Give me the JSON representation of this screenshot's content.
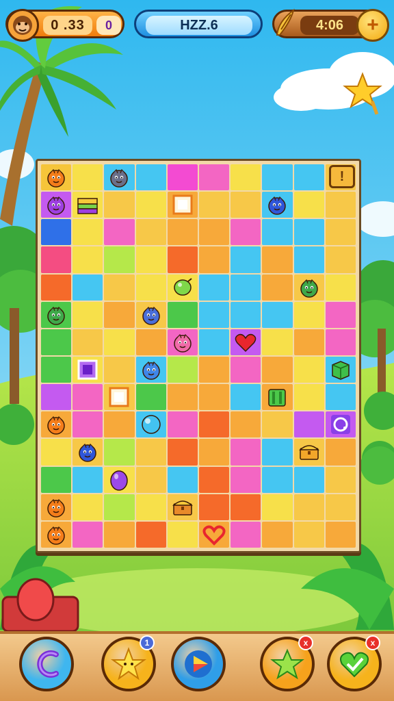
{
  "hud": {
    "score": "0 .33",
    "score_badge": "0",
    "level": "HZZ.6",
    "timer": "4:06",
    "plus_label": "+"
  },
  "board": {
    "menu_label": "!",
    "rows": [
      [
        "#f6c53a",
        "#f7e04a",
        "#45c6f2",
        "#45c6f2",
        "#f34bd2",
        "#f366c3",
        "#f7e04a",
        "#45c6f2",
        "#45c6f2",
        "#f7c848"
      ],
      [
        "#c45af0",
        "#f7e04a",
        "#f7c848",
        "#f7e04a",
        "#f7a93a",
        "#f7c848",
        "#f7c848",
        "#45c6f2",
        "#f7e04a",
        "#f7c848"
      ],
      [
        "#2f70e8",
        "#f7e04a",
        "#f366c3",
        "#f7c848",
        "#f7a93a",
        "#f7a93a",
        "#f366c3",
        "#45c6f2",
        "#45c6f2",
        "#f7c848"
      ],
      [
        "#f44d82",
        "#f7e04a",
        "#b5e84a",
        "#f7e04a",
        "#f56a2a",
        "#f7a93a",
        "#45c6f2",
        "#f7a93a",
        "#45c6f2",
        "#f7c848"
      ],
      [
        "#f56a2a",
        "#45c6f2",
        "#f7c848",
        "#f7e04a",
        "#f7e04a",
        "#45c6f2",
        "#45c6f2",
        "#f7a93a",
        "#f7c848",
        "#f7e04a"
      ],
      [
        "#4cc84a",
        "#f7e04a",
        "#f7a93a",
        "#f7c848",
        "#4cc84a",
        "#45c6f2",
        "#45c6f2",
        "#45c6f2",
        "#f7e04a",
        "#f366c3"
      ],
      [
        "#4cc84a",
        "#f7c848",
        "#f7e04a",
        "#f7a93a",
        "#f366c3",
        "#45c6f2",
        "#c45af0",
        "#f7e04a",
        "#f7a93a",
        "#f366c3"
      ],
      [
        "#4cc84a",
        "#f7e04a",
        "#f7c848",
        "#45c6f2",
        "#b5e84a",
        "#f7a93a",
        "#f366c3",
        "#f7a93a",
        "#f7e04a",
        "#45c6f2"
      ],
      [
        "#c45af0",
        "#f366c3",
        "#f7c848",
        "#4cc84a",
        "#f7a93a",
        "#f7a93a",
        "#45c6f2",
        "#f7a93a",
        "#f7e04a",
        "#45c6f2"
      ],
      [
        "#f7a93a",
        "#f366c3",
        "#f7a93a",
        "#45c6f2",
        "#f366c3",
        "#f56a2a",
        "#f7a93a",
        "#f7c848",
        "#c45af0",
        "#c45af0"
      ],
      [
        "#f7e04a",
        "#f7c848",
        "#b5e84a",
        "#f7c848",
        "#f56a2a",
        "#f7a93a",
        "#f366c3",
        "#45c6f2",
        "#f7c848",
        "#f7a93a"
      ],
      [
        "#4cc84a",
        "#45c6f2",
        "#f7e04a",
        "#f7c848",
        "#45c6f2",
        "#f56a2a",
        "#f366c3",
        "#45c6f2",
        "#45c6f2",
        "#f7c848"
      ],
      [
        "#f7a93a",
        "#f7e04a",
        "#b5e84a",
        "#f7e04a",
        "#f7c848",
        "#f56a2a",
        "#f56a2a",
        "#f7e04a",
        "#f7c848",
        "#f7c848"
      ],
      [
        "#f7a93a",
        "#f366c3",
        "#f7a93a",
        "#f56a2a",
        "#f7e04a",
        "#f7a93a",
        "#f366c3",
        "#f7a93a",
        "#f7c848",
        "#f7a93a"
      ]
    ],
    "pieces": [
      {
        "r": 0,
        "c": 0,
        "icon": "orange-blob-icon",
        "color": "#f47d1a"
      },
      {
        "r": 0,
        "c": 2,
        "icon": "gray-robot-icon",
        "color": "#6a6f8a"
      },
      {
        "r": 1,
        "c": 0,
        "icon": "purple-wizard-icon",
        "color": "#9d3fe0"
      },
      {
        "r": 1,
        "c": 1,
        "icon": "stack-box-icon",
        "color": "#7bd24a"
      },
      {
        "r": 1,
        "c": 4,
        "icon": "white-frame-icon",
        "color": "#ffffff"
      },
      {
        "r": 1,
        "c": 7,
        "icon": "blue-bird-icon",
        "color": "#2f56d8"
      },
      {
        "r": 4,
        "c": 4,
        "icon": "green-bubble-icon",
        "color": "#7fd84a"
      },
      {
        "r": 4,
        "c": 8,
        "icon": "green-hood-icon",
        "color": "#3fa84a"
      },
      {
        "r": 5,
        "c": 0,
        "icon": "green-turtle-icon",
        "color": "#3fa84a"
      },
      {
        "r": 5,
        "c": 3,
        "icon": "blue-robot-icon",
        "color": "#4a6ed8"
      },
      {
        "r": 6,
        "c": 4,
        "icon": "pink-blob-icon",
        "color": "#f06aa8"
      },
      {
        "r": 6,
        "c": 6,
        "icon": "heart-icon",
        "color": "#e8262e"
      },
      {
        "r": 7,
        "c": 1,
        "icon": "purple-frame-icon",
        "color": "#8a2fe0"
      },
      {
        "r": 7,
        "c": 3,
        "icon": "blue-blob-icon",
        "color": "#3f86e8"
      },
      {
        "r": 7,
        "c": 9,
        "icon": "green-box-icon",
        "color": "#3fbf4a"
      },
      {
        "r": 8,
        "c": 2,
        "icon": "white-frame-icon",
        "color": "#ffffff"
      },
      {
        "r": 8,
        "c": 7,
        "icon": "green-gate-icon",
        "color": "#4cc84a"
      },
      {
        "r": 9,
        "c": 0,
        "icon": "orange-blob-icon",
        "color": "#f47d1a"
      },
      {
        "r": 9,
        "c": 3,
        "icon": "cyan-orb-icon",
        "color": "#43c3f0"
      },
      {
        "r": 9,
        "c": 9,
        "icon": "purple-ring-icon",
        "color": "#6a22c8"
      },
      {
        "r": 10,
        "c": 1,
        "icon": "blue-bird-icon",
        "color": "#2f56d8"
      },
      {
        "r": 10,
        "c": 8,
        "icon": "treasure-chest-icon",
        "color": "#f2a62a"
      },
      {
        "r": 11,
        "c": 2,
        "icon": "purple-gem-icon",
        "color": "#9b4ae8"
      },
      {
        "r": 12,
        "c": 0,
        "icon": "orange-blob-icon",
        "color": "#f47d1a"
      },
      {
        "r": 12,
        "c": 4,
        "icon": "treasure-chest-icon",
        "color": "#e88a2a"
      },
      {
        "r": 13,
        "c": 0,
        "icon": "orange-blob-icon",
        "color": "#f47d1a"
      },
      {
        "r": 13,
        "c": 5,
        "icon": "heart-outline-icon",
        "color": "#e8262e"
      }
    ]
  },
  "actions": [
    {
      "name": "undo-button",
      "icon": "undo-icon",
      "bg": "#3fb6ef",
      "badge": ""
    },
    {
      "name": "star-hint-button",
      "icon": "star-icon",
      "bg": "#f6b31c",
      "badge": "1"
    },
    {
      "name": "play-button",
      "icon": "play-icon",
      "bg": "#2f9ee8",
      "badge": ""
    },
    {
      "name": "green-star-button",
      "icon": "green-star-icon",
      "bg": "#f6a21c",
      "badge": "x"
    },
    {
      "name": "heart-boost-button",
      "icon": "green-heart-icon",
      "bg": "#f6b31c",
      "badge": "x"
    }
  ]
}
